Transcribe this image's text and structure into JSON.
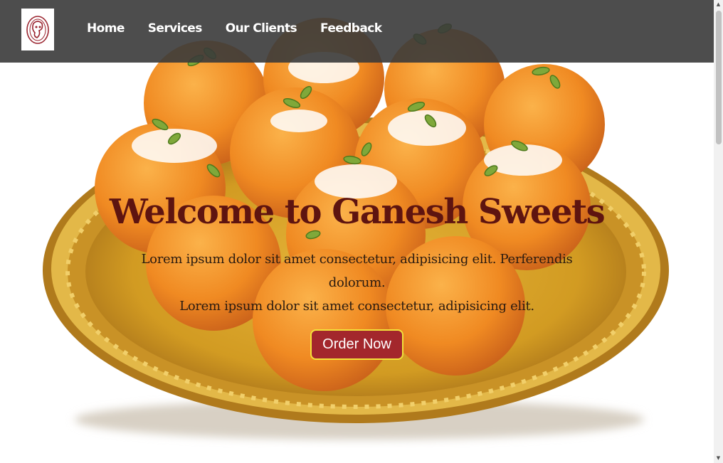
{
  "nav": {
    "items": [
      {
        "label": "Home"
      },
      {
        "label": "Services"
      },
      {
        "label": "Our Clients"
      },
      {
        "label": "Feedback"
      }
    ]
  },
  "hero": {
    "title": "Welcome to Ganesh Sweets",
    "line1": "Lorem ipsum dolor sit amet consectetur, adipisicing elit. Perferendis dolorum.",
    "line2": "Lorem ipsum dolor sit amet consectetur, adipisicing elit.",
    "cta": "Order Now"
  },
  "colors": {
    "navbar": "#3a3a3a",
    "title": "#5e1410",
    "button": "#a3272c",
    "button_border": "#f2e23a",
    "laddoo": "#f0902a",
    "plate": "#d9a92c"
  },
  "icons": {
    "logo": "ganesh-logo-icon",
    "scroll_up": "scroll-up-arrow-icon",
    "scroll_down": "scroll-down-arrow-icon"
  }
}
